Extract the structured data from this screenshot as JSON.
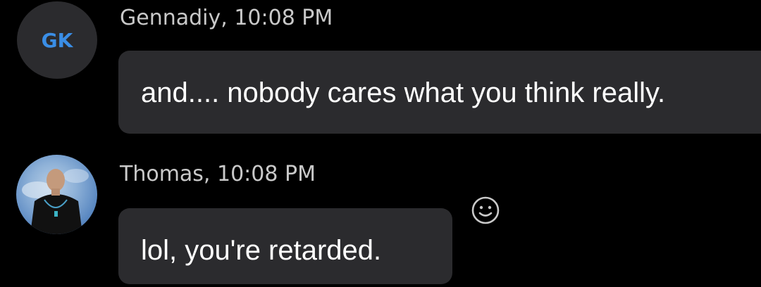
{
  "messages": [
    {
      "sender": "Gennadiy, 10:08 PM",
      "avatar_initials": "GK",
      "initials_color": "#3a8ee6",
      "text": "and.... nobody cares what you think really."
    },
    {
      "sender": "Thomas, 10:08 PM",
      "avatar_type": "photo",
      "text": "lol, you're retarded."
    }
  ],
  "reaction_icon": "smiley-reaction-icon",
  "colors": {
    "background": "#000000",
    "bubble": "#2b2b2e",
    "sender_text": "#c9c9c9",
    "message_text": "#ffffff"
  }
}
